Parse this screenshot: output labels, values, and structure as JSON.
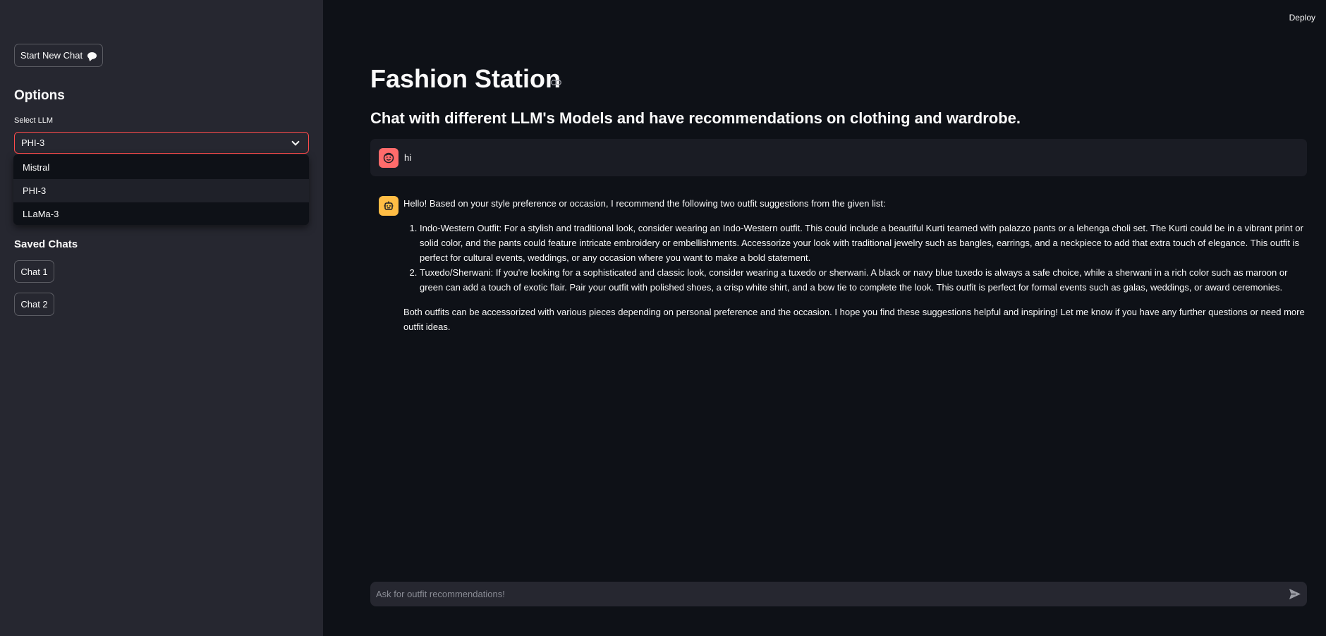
{
  "sidebar": {
    "new_chat_label": "Start New Chat",
    "options_heading": "Options",
    "select_label": "Select LLM",
    "selected_value": "PHI-3",
    "options": [
      "Mistral",
      "PHI-3",
      "LLaMa-3"
    ],
    "saved_heading": "Saved Chats",
    "saved_chats": [
      "Chat 1",
      "Chat 2"
    ]
  },
  "header": {
    "deploy_label": "Deploy"
  },
  "main": {
    "title": "Fashion Station",
    "subtitle": "Chat with different LLM's Models and have recommendations on clothing and wardrobe.",
    "messages": [
      {
        "role": "user",
        "text": "hi"
      },
      {
        "role": "assistant",
        "intro": "Hello! Based on your style preference or occasion, I recommend the following two outfit suggestions from the given list:",
        "items": [
          "Indo-Western Outfit: For a stylish and traditional look, consider wearing an Indo-Western outfit. This could include a beautiful Kurti teamed with palazzo pants or a lehenga choli set. The Kurti could be in a vibrant print or solid color, and the pants could feature intricate embroidery or embellishments. Accessorize your look with traditional jewelry such as bangles, earrings, and a neckpiece to add that extra touch of elegance. This outfit is perfect for cultural events, weddings, or any occasion where you want to make a bold statement.",
          "Tuxedo/Sherwani: If you're looking for a sophisticated and classic look, consider wearing a tuxedo or sherwani. A black or navy blue tuxedo is always a safe choice, while a sherwani in a rich color such as maroon or green can add a touch of exotic flair. Pair your outfit with polished shoes, a crisp white shirt, and a bow tie to complete the look. This outfit is perfect for formal events such as galas, weddings, or award ceremonies."
        ],
        "outro": "Both outfits can be accessorized with various pieces depending on personal preference and the occasion. I hope you find these suggestions helpful and inspiring! Let me know if you have any further questions or need more outfit ideas."
      }
    ]
  },
  "chat_input": {
    "placeholder": "Ask for outfit recommendations!"
  },
  "colors": {
    "sidebar_bg": "#262730",
    "main_bg": "#0e1117",
    "accent_red": "#ff4b4b",
    "user_avatar": "#ff6b6b",
    "bot_avatar": "#ffbd45"
  }
}
